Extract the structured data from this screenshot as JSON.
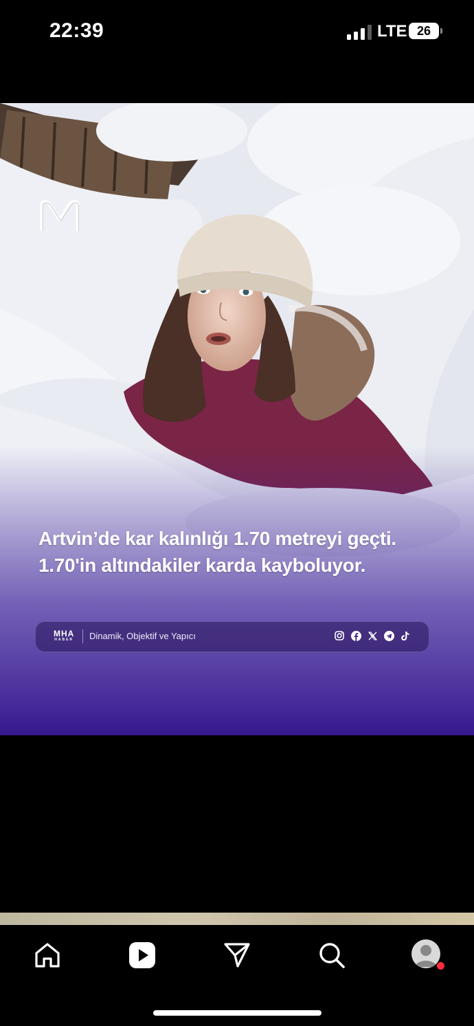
{
  "status_bar": {
    "time": "22:39",
    "network": "LTE",
    "battery": "26"
  },
  "post": {
    "headline_line1": "Artvin’de kar kalınlığı 1.70 metreyi geçti.",
    "headline_line2": "1.70'in altındakiler karda kayboluyor.",
    "brand": "MHA",
    "brand_sub": "HABER",
    "tagline": "Dinamik, Objektif ve Yapıcı",
    "social_icons": [
      "instagram-icon",
      "facebook-icon",
      "x-icon",
      "telegram-icon",
      "tiktok-icon"
    ]
  },
  "tab_bar": {
    "items": [
      "home-icon",
      "reels-icon",
      "send-icon",
      "search-icon",
      "profile-avatar"
    ],
    "notification_dot_color": "#ff2d3f"
  },
  "colors": {
    "gradient_bottom": "#3a1e95",
    "background": "#000000"
  }
}
